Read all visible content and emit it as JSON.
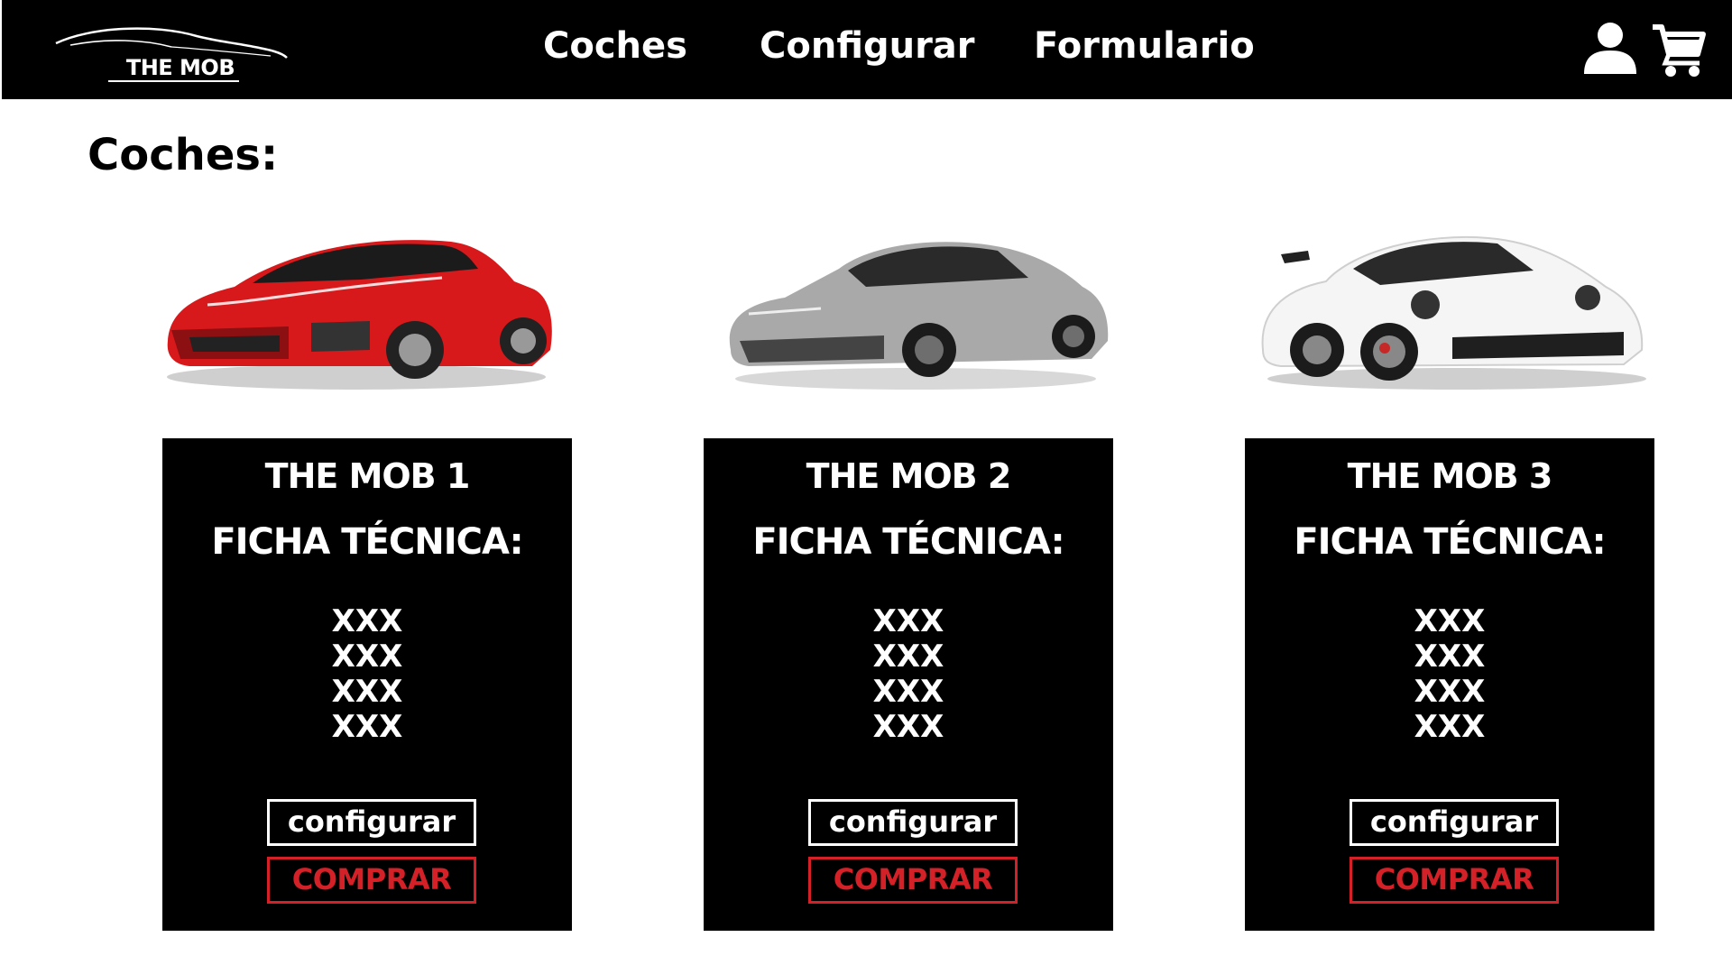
{
  "header": {
    "logo_text": "THE MOB",
    "nav": [
      "Coches",
      "Configurar",
      "Formulario"
    ],
    "icons": [
      "user-icon",
      "cart-icon"
    ]
  },
  "main": {
    "section_title": "Coches:",
    "cars": [
      {
        "image": "red-sports-car",
        "title": "THE MOB 1",
        "subtitle": "FICHA TÉCNICA:",
        "specs": [
          "XXX",
          "XXX",
          "XXX",
          "XXX"
        ],
        "configure_label": "configurar",
        "buy_label": "COMPRAR"
      },
      {
        "image": "grey-sedan-car",
        "title": "THE MOB 2",
        "subtitle": "FICHA TÉCNICA:",
        "specs": [
          "XXX",
          "XXX",
          "XXX",
          "XXX"
        ],
        "configure_label": "configurar",
        "buy_label": "COMPRAR"
      },
      {
        "image": "white-sports-car",
        "title": "THE MOB 3",
        "subtitle": "FICHA TÉCNICA:",
        "specs": [
          "XXX",
          "XXX",
          "XXX",
          "XXX"
        ],
        "configure_label": "configurar",
        "buy_label": "COMPRAR"
      }
    ]
  },
  "colors": {
    "header_bg": "#000000",
    "card_bg": "#000000",
    "buy_accent": "#d42027",
    "text_light": "#ffffff"
  }
}
